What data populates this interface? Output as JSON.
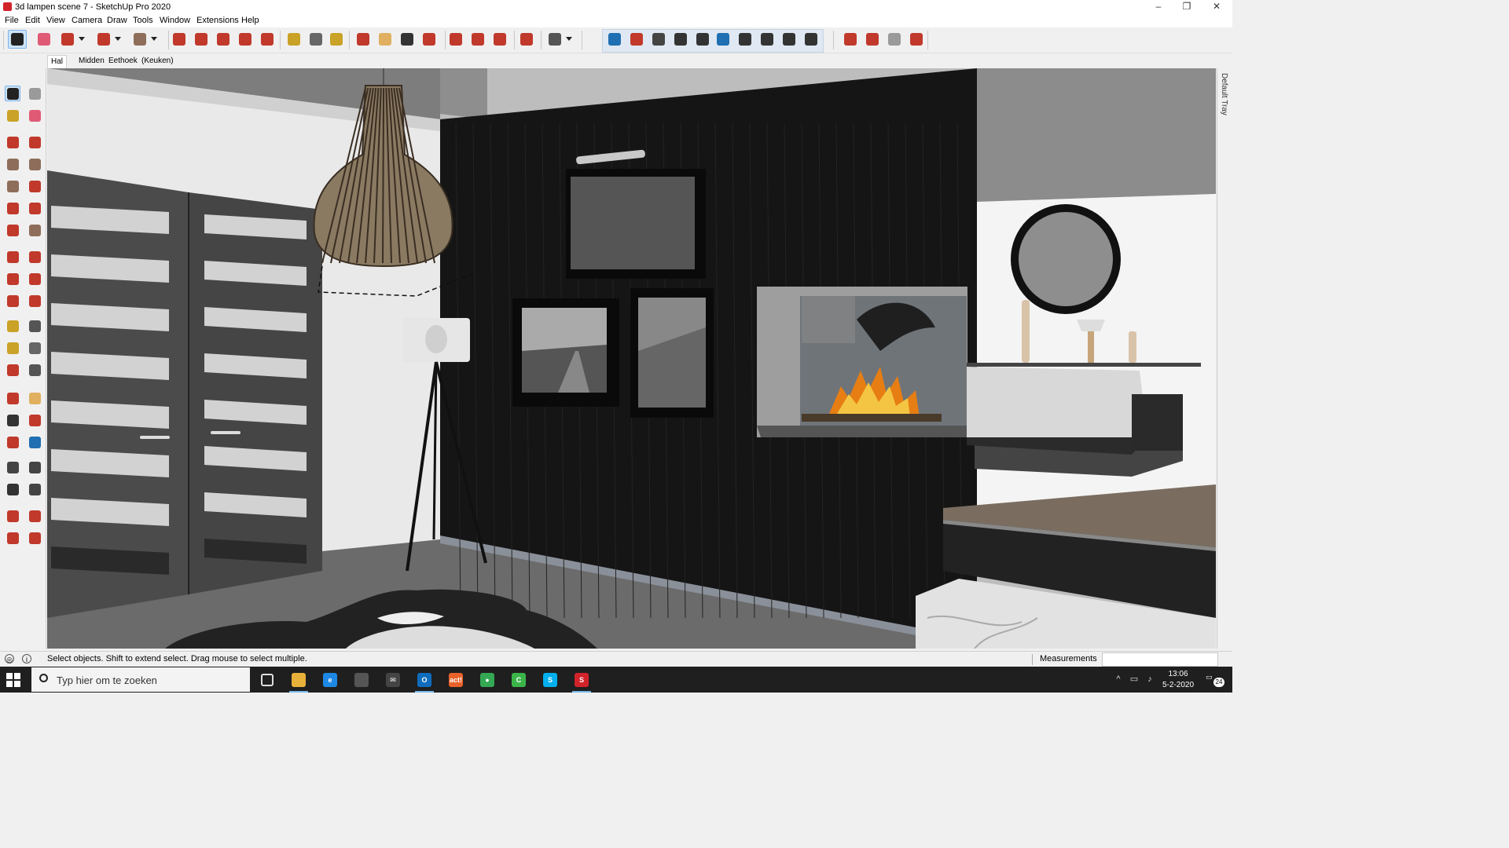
{
  "window": {
    "title": "3d lampen scene 7 - SketchUp Pro 2020",
    "minimize": "–",
    "maximize": "❐",
    "close": "✕"
  },
  "menu": [
    "File",
    "Edit",
    "View",
    "Camera",
    "Draw",
    "Tools",
    "Window",
    "Extensions",
    "Help"
  ],
  "toolbar": [
    {
      "name": "select-tool",
      "color": "#222222",
      "active": true
    },
    {
      "name": "eraser-tool",
      "color": "#e05a76"
    },
    {
      "name": "line-tool",
      "color": "#c0392b",
      "dropdown": true
    },
    {
      "name": "arc-tool",
      "color": "#c0392b",
      "dropdown": true
    },
    {
      "name": "rectangle-tool",
      "color": "#8e6e5a",
      "dropdown": true
    },
    {
      "name": "push-pull-tool",
      "color": "#c0392b"
    },
    {
      "name": "offset-tool",
      "color": "#c0392b"
    },
    {
      "name": "move-tool",
      "color": "#c0392b"
    },
    {
      "name": "rotate-tool",
      "color": "#c0392b"
    },
    {
      "name": "scale-tool",
      "color": "#c0392b"
    },
    {
      "name": "tape-measure-tool",
      "color": "#c9a227"
    },
    {
      "name": "text-tool",
      "color": "#666666"
    },
    {
      "name": "paint-bucket-tool",
      "color": "#c9a227"
    },
    {
      "name": "orbit-tool",
      "color": "#c0392b"
    },
    {
      "name": "pan-tool",
      "color": "#e0b060"
    },
    {
      "name": "zoom-tool",
      "color": "#333333"
    },
    {
      "name": "zoom-extents-tool",
      "color": "#c0392b"
    },
    {
      "name": "warehouse-tool",
      "color": "#c0392b"
    },
    {
      "name": "extension-warehouse-tool",
      "color": "#c0392b"
    },
    {
      "name": "share-model-tool",
      "color": "#c0392b"
    },
    {
      "name": "ruby-console-tool",
      "color": "#c0392b"
    },
    {
      "name": "user-account-tool",
      "color": "#555555",
      "dropdown": true
    },
    {
      "name": "vray-render-tool",
      "color": "#1f6fb2"
    },
    {
      "name": "vray-interactive-tool",
      "color": "#c0392b"
    },
    {
      "name": "vray-cursor-tool",
      "color": "#444444"
    },
    {
      "name": "vray-settings-tool",
      "color": "#333333"
    },
    {
      "name": "vray-frame-buffer-tool",
      "color": "#333333"
    },
    {
      "name": "vray-light-tool",
      "color": "#1f6fb2"
    },
    {
      "name": "vray-camera-tool",
      "color": "#333333"
    },
    {
      "name": "vray-image-tool",
      "color": "#333333"
    },
    {
      "name": "vray-chart-tool",
      "color": "#333333"
    },
    {
      "name": "vray-globe-tool",
      "color": "#333333"
    },
    {
      "name": "plugin-tool-1",
      "color": "#c0392b"
    },
    {
      "name": "plugin-tool-2",
      "color": "#c0392b"
    },
    {
      "name": "plugin-tool-3",
      "color": "#9a9a9a"
    },
    {
      "name": "plugin-tool-4",
      "color": "#c0392b"
    }
  ],
  "scenes": [
    "Hal",
    "Midden",
    "Eethoek",
    "(Keuken)"
  ],
  "left_tools": [
    {
      "name": "select-tool",
      "color": "#222222",
      "active": true
    },
    {
      "name": "component-tool",
      "color": "#9a9a9a"
    },
    {
      "name": "paint-bucket-tool",
      "color": "#c9a227"
    },
    {
      "name": "eraser-tool",
      "color": "#e05a76"
    },
    {
      "name": "line-tool",
      "color": "#c0392b"
    },
    {
      "name": "freehand-tool",
      "color": "#c0392b"
    },
    {
      "name": "rectangle-tool",
      "color": "#8e6e5a"
    },
    {
      "name": "rotated-rectangle-tool",
      "color": "#8e6e5a"
    },
    {
      "name": "circle-tool",
      "color": "#8e6e5a"
    },
    {
      "name": "polygon-tool",
      "color": "#c0392b"
    },
    {
      "name": "arc-tool",
      "color": "#c0392b"
    },
    {
      "name": "two-point-arc-tool",
      "color": "#c0392b"
    },
    {
      "name": "three-point-arc-tool",
      "color": "#c0392b"
    },
    {
      "name": "pie-tool",
      "color": "#8e6e5a"
    },
    {
      "name": "move-tool",
      "color": "#c0392b"
    },
    {
      "name": "push-pull-tool",
      "color": "#c0392b"
    },
    {
      "name": "rotate-tool",
      "color": "#c0392b"
    },
    {
      "name": "follow-me-tool",
      "color": "#c0392b"
    },
    {
      "name": "scale-tool",
      "color": "#c0392b"
    },
    {
      "name": "offset-tool",
      "color": "#c0392b"
    },
    {
      "name": "tape-measure-tool",
      "color": "#c9a227"
    },
    {
      "name": "dimension-tool",
      "color": "#555555"
    },
    {
      "name": "protractor-tool",
      "color": "#c9a227"
    },
    {
      "name": "text-tool",
      "color": "#666666"
    },
    {
      "name": "axes-tool",
      "color": "#c0392b"
    },
    {
      "name": "3d-text-tool",
      "color": "#555555"
    },
    {
      "name": "orbit-tool",
      "color": "#c0392b"
    },
    {
      "name": "pan-tool",
      "color": "#e0b060"
    },
    {
      "name": "zoom-tool",
      "color": "#333333"
    },
    {
      "name": "zoom-window-tool",
      "color": "#c0392b"
    },
    {
      "name": "zoom-extents-tool",
      "color": "#c0392b"
    },
    {
      "name": "previous-view-tool",
      "color": "#1f6fb2"
    },
    {
      "name": "position-camera-tool",
      "color": "#444444"
    },
    {
      "name": "look-around-tool",
      "color": "#444444"
    },
    {
      "name": "walk-tool",
      "color": "#333333"
    },
    {
      "name": "section-plane-tool",
      "color": "#444444"
    },
    {
      "name": "warehouse-tool",
      "color": "#c0392b"
    },
    {
      "name": "extension-warehouse-tool",
      "color": "#c0392b"
    },
    {
      "name": "share-model-tool",
      "color": "#c0392b"
    },
    {
      "name": "ruby-console-tool",
      "color": "#c0392b"
    }
  ],
  "tray_label": "Default Tray",
  "status": {
    "hint": "Select objects. Shift to extend select. Drag mouse to select multiple.",
    "measurements_label": "Measurements",
    "measurements_value": ""
  },
  "taskbar": {
    "search_placeholder": "Typ hier om te zoeken",
    "apps": [
      {
        "name": "task-view",
        "color": "#1f1f1f",
        "label": ""
      },
      {
        "name": "file-explorer",
        "color": "#e8b13a",
        "label": ""
      },
      {
        "name": "edge",
        "color": "#1e88e5",
        "label": "e"
      },
      {
        "name": "store",
        "color": "#555555",
        "label": ""
      },
      {
        "name": "mail",
        "color": "#444444",
        "label": "✉"
      },
      {
        "name": "outlook",
        "color": "#0f6cbd",
        "label": "O"
      },
      {
        "name": "act",
        "color": "#e8622a",
        "label": "act!"
      },
      {
        "name": "chrome",
        "color": "#34a853",
        "label": "●"
      },
      {
        "name": "camtasia",
        "color": "#3bb54a",
        "label": "C"
      },
      {
        "name": "skype",
        "color": "#00aff0",
        "label": "S"
      },
      {
        "name": "sketchup",
        "color": "#d2232a",
        "label": "S"
      }
    ],
    "time": "13:06",
    "date": "5-2-2020",
    "notifications": "24"
  }
}
